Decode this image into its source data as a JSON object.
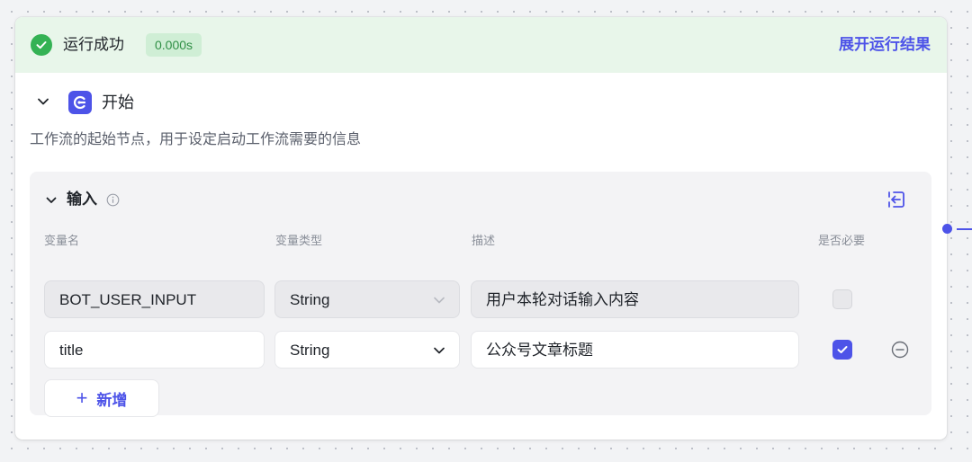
{
  "status": {
    "text": "运行成功",
    "time": "0.000s",
    "expand_label": "展开运行结果"
  },
  "node": {
    "title": "开始",
    "description": "工作流的起始节点，用于设定启动工作流需要的信息"
  },
  "inputs": {
    "title": "输入",
    "columns": {
      "name": "变量名",
      "type": "变量类型",
      "description": "描述",
      "required": "是否必要"
    },
    "rows": [
      {
        "name": "BOT_USER_INPUT",
        "type": "String",
        "description": "用户本轮对话输入内容",
        "required": false,
        "editable": false
      },
      {
        "name": "title",
        "type": "String",
        "description": "公众号文章标题",
        "required": true,
        "editable": true
      }
    ],
    "add_label": "新增"
  },
  "colors": {
    "accent": "#4d53e8",
    "success": "#34b254",
    "success_bg": "#e8f6ea"
  }
}
